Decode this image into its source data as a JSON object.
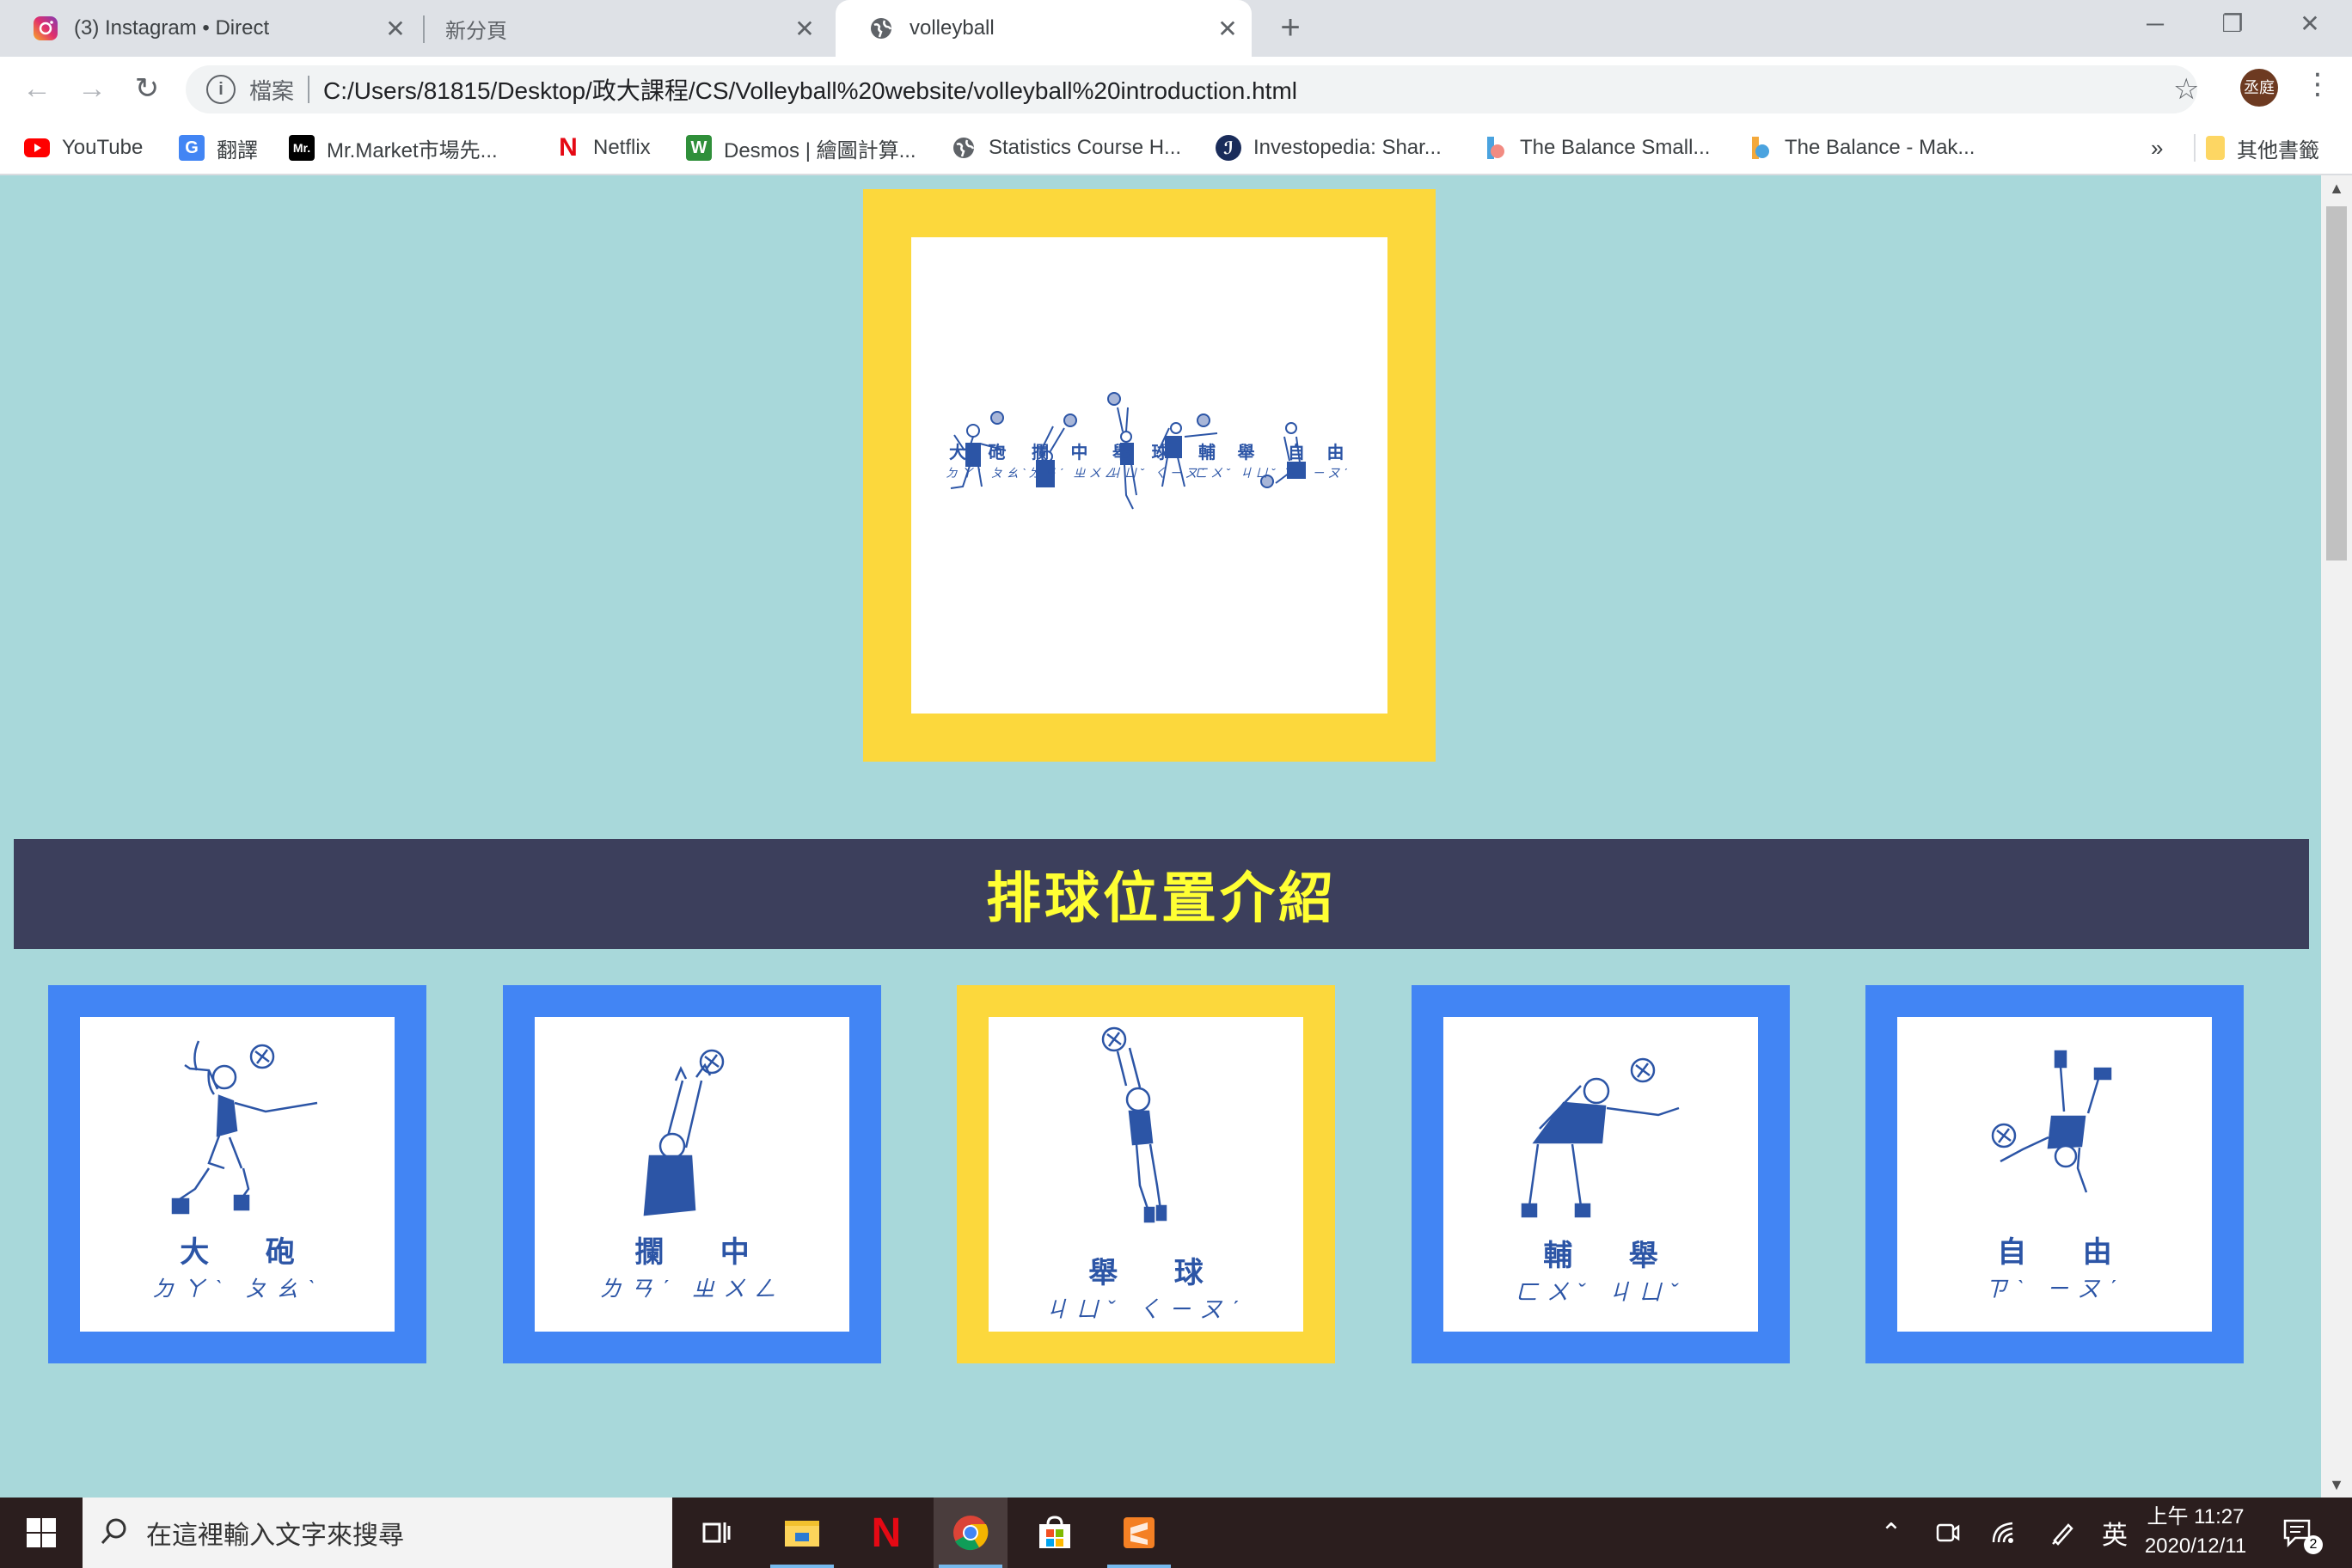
{
  "browser": {
    "tabs": [
      {
        "title": "(3) Instagram • Direct",
        "icon": "instagram-icon"
      },
      {
        "title": "新分頁",
        "icon": "none"
      },
      {
        "title": "volleyball",
        "icon": "globe-icon"
      }
    ],
    "active_tab_index": 2,
    "omnibox": {
      "label": "檔案",
      "url": "C:/Users/81815/Desktop/政大課程/CS/Volleyball%20website/volleyball%20introduction.html"
    },
    "profile_initials": "丞庭",
    "bookmarks": [
      {
        "label": "YouTube",
        "icon": "youtube-icon"
      },
      {
        "label": "翻譯",
        "icon": "translate-icon"
      },
      {
        "label": "Mr.Market市場先...",
        "icon": "mr-market-icon"
      },
      {
        "label": "Netflix",
        "icon": "netflix-icon"
      },
      {
        "label": "Desmos | 繪圖計算...",
        "icon": "desmos-icon"
      },
      {
        "label": "Statistics Course H...",
        "icon": "globe-icon"
      },
      {
        "label": "Investopedia: Shar...",
        "icon": "investopedia-icon"
      },
      {
        "label": "The Balance Small...",
        "icon": "balance-icon"
      },
      {
        "label": "The Balance - Mak...",
        "icon": "balance-icon"
      }
    ],
    "bookmarks_overflow": "»",
    "other_bookmarks": "其他書籤"
  },
  "page": {
    "banner_title": "排球位置介紹",
    "hero": {
      "labels": [
        {
          "name": "大 砲",
          "sub": "ㄉㄚˋ ㄆㄠˋ"
        },
        {
          "name": "攔 中",
          "sub": "ㄌㄢˊ ㄓㄨㄥ"
        },
        {
          "name": "舉 球",
          "sub": "ㄐㄩˇ ㄑㄧㄡˊ"
        },
        {
          "name": "輔 舉",
          "sub": "ㄈㄨˇ ㄐㄩˇ"
        },
        {
          "name": "自 由",
          "sub": "ㄗˋ ㄧㄡˊ"
        }
      ]
    },
    "positions": [
      {
        "name": "大 砲",
        "sub": "ㄉㄚˋ ㄆㄠˋ",
        "frame_color": "#4285f4",
        "pose": "spiker"
      },
      {
        "name": "攔 中",
        "sub": "ㄌㄢˊ ㄓㄨㄥ",
        "frame_color": "#4285f4",
        "pose": "blocker"
      },
      {
        "name": "舉 球",
        "sub": "ㄐㄩˇ ㄑㄧㄡˊ",
        "frame_color": "#fcd83c",
        "pose": "setter"
      },
      {
        "name": "輔 舉",
        "sub": "ㄈㄨˇ ㄐㄩˇ",
        "frame_color": "#4285f4",
        "pose": "opposite"
      },
      {
        "name": "自 由",
        "sub": "ㄗˋ ㄧㄡˊ",
        "frame_color": "#4285f4",
        "pose": "libero"
      }
    ]
  },
  "taskbar": {
    "search_placeholder": "在這裡輸入文字來搜尋",
    "ime": "英",
    "time": "上午 11:27",
    "date": "2020/12/11",
    "notifications": "2"
  },
  "colors": {
    "page_bg": "#a8d8da",
    "hero_frame": "#fcd83c",
    "card_blue": "#4285f4",
    "banner_bg": "#3c3f5c",
    "banner_text": "#ffff33",
    "figure_blue": "#2c55a6"
  }
}
